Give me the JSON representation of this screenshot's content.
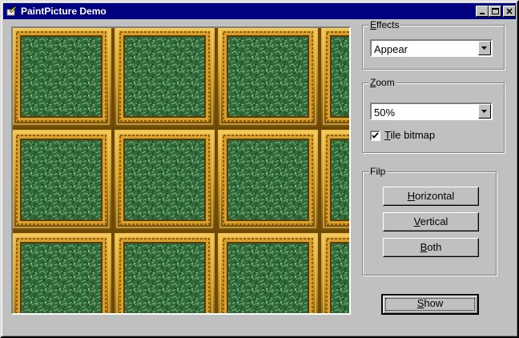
{
  "window": {
    "title": "PaintPicture Demo"
  },
  "icons": {
    "system": "paint-brush-icon",
    "minimize": "minimize-icon",
    "maximize": "maximize-icon",
    "close": "close-icon"
  },
  "effects": {
    "label_u": "E",
    "label_rest": "ffects",
    "selected": "Appear"
  },
  "zoom": {
    "label_u": "Z",
    "label_rest": "oom",
    "selected": "50%",
    "tile_label_u": "T",
    "tile_label_rest": "ile bitmap",
    "tile_checked": true
  },
  "flip": {
    "label": "Filp",
    "horizontal_u": "H",
    "horizontal_rest": "orizontal",
    "vertical_u": "V",
    "vertical_rest": "ertical",
    "both_u": "B",
    "both_rest": "oth"
  },
  "show": {
    "label_u": "S",
    "label_rest": "how"
  },
  "colors": {
    "titlebar": "#000080",
    "face": "#c0c0c0",
    "frame_gold": "#c8901a",
    "foliage": "#2f6b3a"
  }
}
